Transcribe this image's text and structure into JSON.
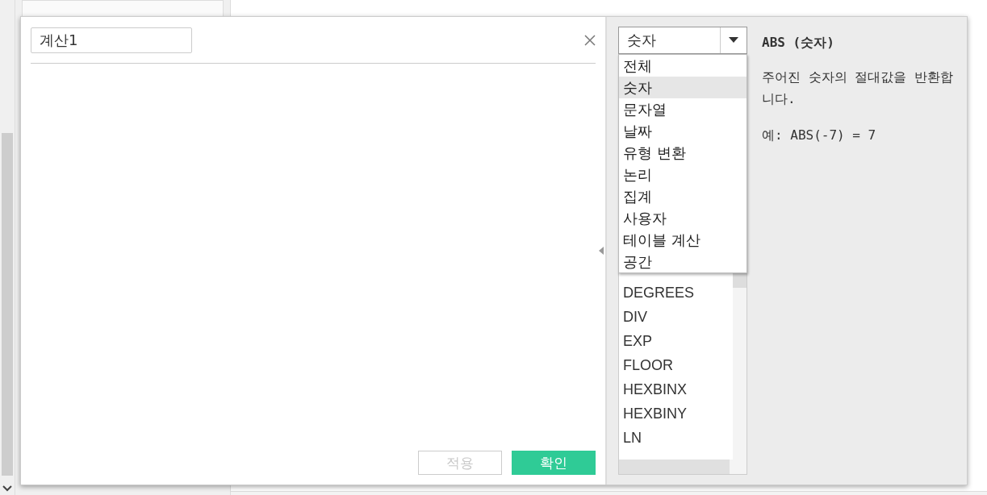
{
  "dialog": {
    "name_value": "계산1",
    "category_select": {
      "value": "숫자"
    },
    "category_options": [
      {
        "label": "전체",
        "selected": false
      },
      {
        "label": "숫자",
        "selected": true
      },
      {
        "label": "문자열",
        "selected": false
      },
      {
        "label": "날짜",
        "selected": false
      },
      {
        "label": "유형 변환",
        "selected": false
      },
      {
        "label": "논리",
        "selected": false
      },
      {
        "label": "집계",
        "selected": false
      },
      {
        "label": "사용자",
        "selected": false
      },
      {
        "label": "테이블 계산",
        "selected": false
      },
      {
        "label": "공간",
        "selected": false
      }
    ],
    "functions": [
      "DEGREES",
      "DIV",
      "EXP",
      "FLOOR",
      "HEXBINX",
      "HEXBINY",
      "LN"
    ],
    "help": {
      "title": "ABS (숫자)",
      "description": "주어진 숫자의 절대값을 반환합니다.",
      "example": "예: ABS(-7) = 7"
    },
    "buttons": [
      {
        "label": "적용",
        "disabled": true,
        "kind": "secondary"
      },
      {
        "label": "확인",
        "disabled": false,
        "kind": "primary"
      }
    ]
  }
}
